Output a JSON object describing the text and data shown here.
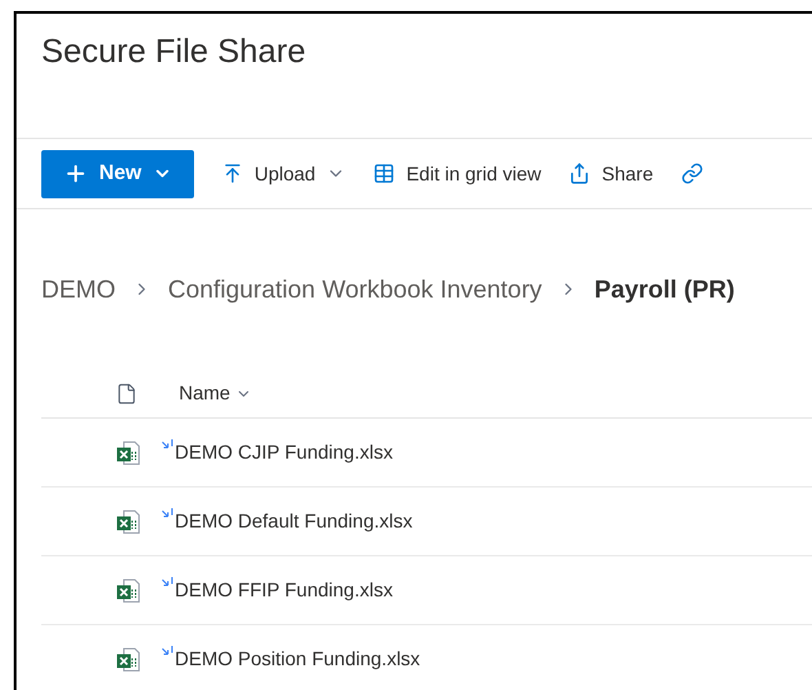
{
  "site": {
    "title": "Secure File Share"
  },
  "toolbar": [
    {
      "kind": "primary",
      "label": "New",
      "dropdown": true
    },
    {
      "kind": "command",
      "label": "Upload",
      "dropdown": true
    },
    {
      "kind": "command",
      "label": "Edit in grid view",
      "dropdown": false
    },
    {
      "kind": "command",
      "label": "Share",
      "dropdown": false
    },
    {
      "kind": "icon_only",
      "dropdown": false
    }
  ],
  "breadcrumb": [
    {
      "label": "DEMO",
      "current": false
    },
    {
      "label": "Configuration Workbook Inventory",
      "current": false
    },
    {
      "label": "Payroll (PR)",
      "current": true
    }
  ],
  "table": {
    "columns": [
      {
        "label": "Name",
        "sortable": true
      }
    ],
    "rows": [
      {
        "name": "DEMO CJIP Funding.xlsx",
        "is_new": true
      },
      {
        "name": "DEMO Default Funding.xlsx",
        "is_new": true
      },
      {
        "name": "DEMO FFIP Funding.xlsx",
        "is_new": true
      },
      {
        "name": "DEMO Position Funding.xlsx",
        "is_new": true
      }
    ]
  }
}
